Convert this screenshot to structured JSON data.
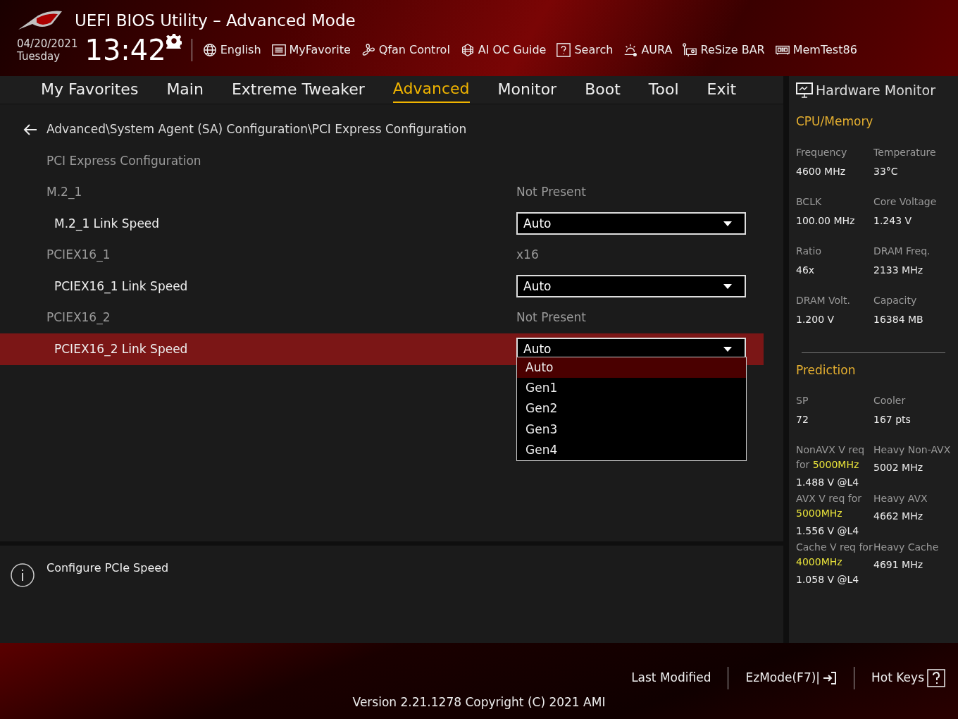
{
  "header": {
    "title": "UEFI BIOS Utility – Advanced Mode",
    "date": "04/20/2021",
    "day": "Tuesday",
    "time": "13:42",
    "tools": [
      {
        "kind": "globe",
        "label": "English"
      },
      {
        "kind": "list",
        "label": "MyFavorite"
      },
      {
        "kind": "fan",
        "label": "Qfan Control"
      },
      {
        "kind": "chip",
        "label": "AI OC Guide"
      },
      {
        "kind": "question",
        "label": "Search"
      },
      {
        "kind": "light",
        "label": "AURA"
      },
      {
        "kind": "card",
        "label": "ReSize BAR"
      },
      {
        "kind": "memory",
        "label": "MemTest86"
      }
    ]
  },
  "tabs": [
    {
      "label": "My Favorites",
      "selected": false
    },
    {
      "label": "Main",
      "selected": false
    },
    {
      "label": "Extreme Tweaker",
      "selected": false
    },
    {
      "label": "Advanced",
      "selected": true
    },
    {
      "label": "Monitor",
      "selected": false
    },
    {
      "label": "Boot",
      "selected": false
    },
    {
      "label": "Tool",
      "selected": false
    },
    {
      "label": "Exit",
      "selected": false
    }
  ],
  "breadcrumb": "Advanced\\System Agent (SA) Configuration\\PCI Express Configuration",
  "settings": [
    {
      "kind": "heading",
      "label": "PCI Express Configuration"
    },
    {
      "kind": "info",
      "label": "M.2_1",
      "value": "Not Present"
    },
    {
      "kind": "select",
      "label": "M.2_1 Link Speed",
      "value": "Auto",
      "selected": false
    },
    {
      "kind": "info",
      "label": "PCIEX16_1",
      "value": "x16"
    },
    {
      "kind": "select",
      "label": "PCIEX16_1 Link Speed",
      "value": "Auto",
      "selected": false
    },
    {
      "kind": "info",
      "label": "PCIEX16_2",
      "value": "Not Present"
    },
    {
      "kind": "select",
      "label": "PCIEX16_2 Link Speed",
      "value": "Auto",
      "selected": true
    }
  ],
  "dropdown": {
    "options": [
      {
        "label": "Auto",
        "selected": true
      },
      {
        "label": "Gen1",
        "selected": false
      },
      {
        "label": "Gen2",
        "selected": false
      },
      {
        "label": "Gen3",
        "selected": false
      },
      {
        "label": "Gen4",
        "selected": false
      }
    ]
  },
  "help": "Configure PCIe Speed",
  "hardware_monitor": {
    "title": "Hardware Monitor",
    "sections": [
      {
        "title": "CPU/Memory",
        "items": [
          {
            "label": "Frequency",
            "value": "4600 MHz"
          },
          {
            "label": "Temperature",
            "value": "33°C"
          },
          {
            "label": "BCLK",
            "value": "100.00 MHz"
          },
          {
            "label": "Core Voltage",
            "value": "1.243 V"
          },
          {
            "label": "Ratio",
            "value": "46x"
          },
          {
            "label": "DRAM Freq.",
            "value": "2133 MHz"
          },
          {
            "label": "DRAM Volt.",
            "value": "1.200 V"
          },
          {
            "label": "Capacity",
            "value": "16384 MB"
          }
        ]
      },
      {
        "title": "Prediction",
        "items": [
          {
            "label": "SP",
            "value": "72"
          },
          {
            "label": "Cooler",
            "value": "167 pts"
          }
        ],
        "requirements": [
          {
            "label": "NonAVX V req for",
            "highlight": "5000MHz",
            "value": "1.488 V @L4",
            "load_label": "Heavy Non-AVX",
            "load_value": "5002 MHz"
          },
          {
            "label": "AVX V req    for",
            "highlight": "5000MHz",
            "value": "1.556 V @L4",
            "load_label": "Heavy AVX",
            "load_value": "4662 MHz"
          },
          {
            "label": "Cache V req for",
            "highlight": "4000MHz",
            "value": "1.058 V @L4",
            "load_label": "Heavy Cache",
            "load_value": "4691 MHz"
          }
        ]
      }
    ]
  },
  "footer": {
    "links": [
      {
        "kind": "text",
        "label": "Last Modified"
      },
      {
        "kind": "exit",
        "label": "EzMode(F7)|"
      },
      {
        "kind": "help",
        "label": "Hot Keys"
      }
    ],
    "version": "Version 2.21.1278 Copyright (C) 2021 AMI"
  }
}
